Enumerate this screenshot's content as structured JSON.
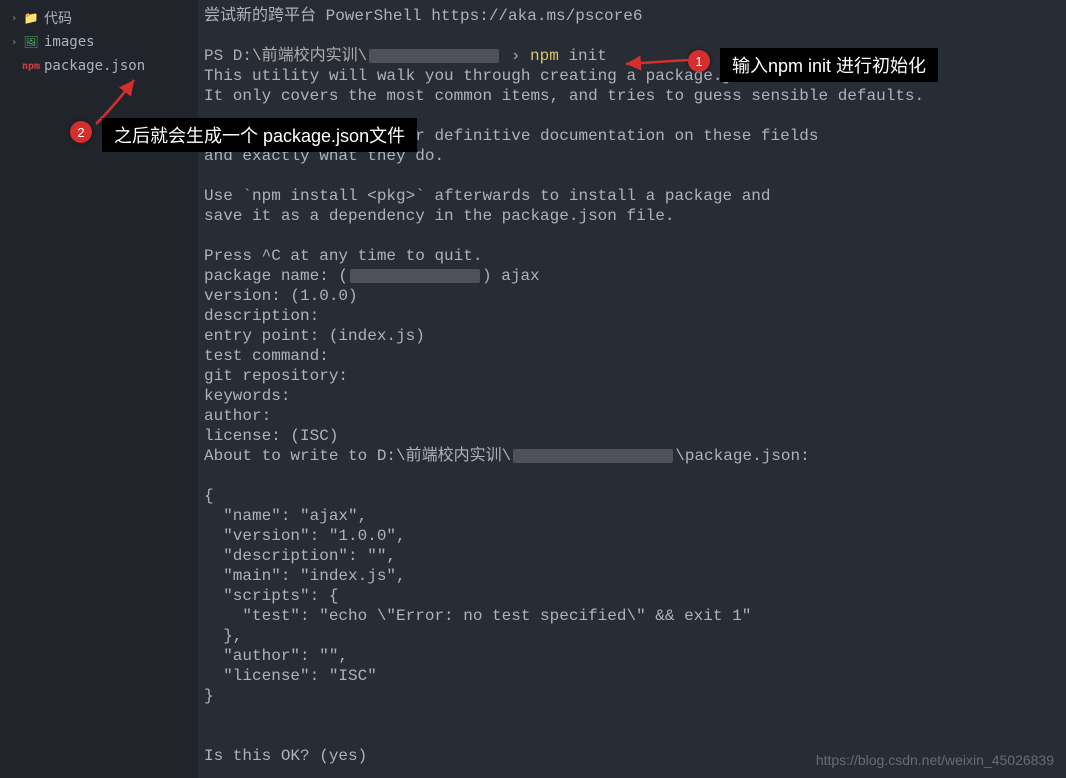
{
  "sidebar": {
    "items": [
      {
        "chev": "›",
        "icon": "📁",
        "iconColor": "#d9a558",
        "label": "代码"
      },
      {
        "chev": "›",
        "icon": "🖼",
        "iconColor": "#48a869",
        "label": "images"
      },
      {
        "chev": "",
        "icon": "npm",
        "iconColor": "#c74343",
        "label": "package.json"
      }
    ]
  },
  "term": {
    "line0": "尝试新的跨平台 PowerShell https://aka.ms/pscore6",
    "prompt": "PS D:\\前端校内实训\\",
    "redactedW1": "130px",
    "promptSymbol": " › ",
    "cmd": "npm",
    "arg": " init",
    "line3": "This utility will walk you through creating a package.json file.",
    "line4": "It only covers the most common items, and tries to guess sensible defaults.",
    "line6a": "See `npm help init` for definitive documentation on these fields",
    "line7": "and exactly what they do.",
    "line9": "Use `npm install <pkg>` afterwards to install a package and",
    "line10": "save it as a dependency in the package.json file.",
    "line12": "Press ^C at any time to quit.",
    "line13a": "package name: (",
    "redactedW2": "130px",
    "line13b": ") ajax",
    "line14": "version: (1.0.0)",
    "line15": "description:",
    "line16": "entry point: (index.js)",
    "line17": "test command:",
    "line18": "git repository:",
    "line19": "keywords:",
    "line20": "author:",
    "line21": "license: (ISC)",
    "line22a": "About to write to D:\\前端校内实训\\",
    "redactedW3": "160px",
    "line22b": "\\package.json:",
    "j0": "{",
    "j1": "  \"name\": \"ajax\",",
    "j2": "  \"version\": \"1.0.0\",",
    "j3": "  \"description\": \"\",",
    "j4": "  \"main\": \"index.js\",",
    "j5": "  \"scripts\": {",
    "j6": "    \"test\": \"echo \\\"Error: no test specified\\\" && exit 1\"",
    "j7": "  },",
    "j8": "  \"author\": \"\",",
    "j9": "  \"license\": \"ISC\"",
    "j10": "}",
    "lineEnd": "Is this OK? (yes)"
  },
  "annot": {
    "badge1": "1",
    "callout1": "输入npm init 进行初始化",
    "badge2": "2",
    "callout2": "之后就会生成一个 package.json文件"
  },
  "watermark": "https://blog.csdn.net/weixin_45026839",
  "colors": {
    "arrow": "#d32f2f"
  }
}
